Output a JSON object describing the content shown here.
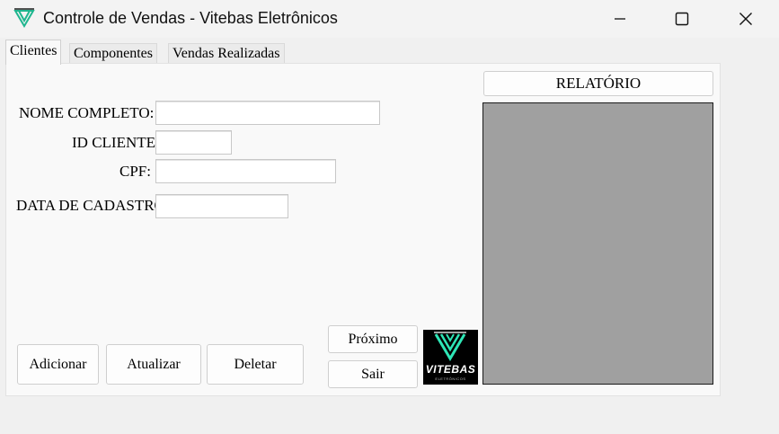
{
  "window": {
    "title": "Controle de Vendas - Vitebas Eletrônicos",
    "controls": [
      "minimize-icon",
      "maximize-icon",
      "close-icon"
    ]
  },
  "tabs": [
    {
      "label": "Clientes",
      "active": true
    },
    {
      "label": "Componentes",
      "active": false
    },
    {
      "label": "Vendas Realizadas",
      "active": false
    }
  ],
  "form": {
    "nome_completo": {
      "label": "NOME COMPLETO:",
      "value": ""
    },
    "id_cliente": {
      "label": "ID CLIENTE:",
      "value": ""
    },
    "cpf": {
      "label": "CPF:",
      "value": ""
    },
    "data_cadastro": {
      "label": "DATA DE CADASTRO:",
      "value": ""
    }
  },
  "buttons": {
    "adicionar": "Adicionar",
    "atualizar": "Atualizar",
    "deletar": "Deletar",
    "proximo": "Próximo",
    "sair": "Sair",
    "relatorio": "RELATÓRIO"
  },
  "logo": {
    "text": "VITEBAS",
    "subtext": "ELETRÔNICOS",
    "accent_color": "#2ee6b6"
  },
  "colors": {
    "report_canvas": "#a0a0a0",
    "panel": "#f9f9f9",
    "window": "#f0f0f0"
  }
}
